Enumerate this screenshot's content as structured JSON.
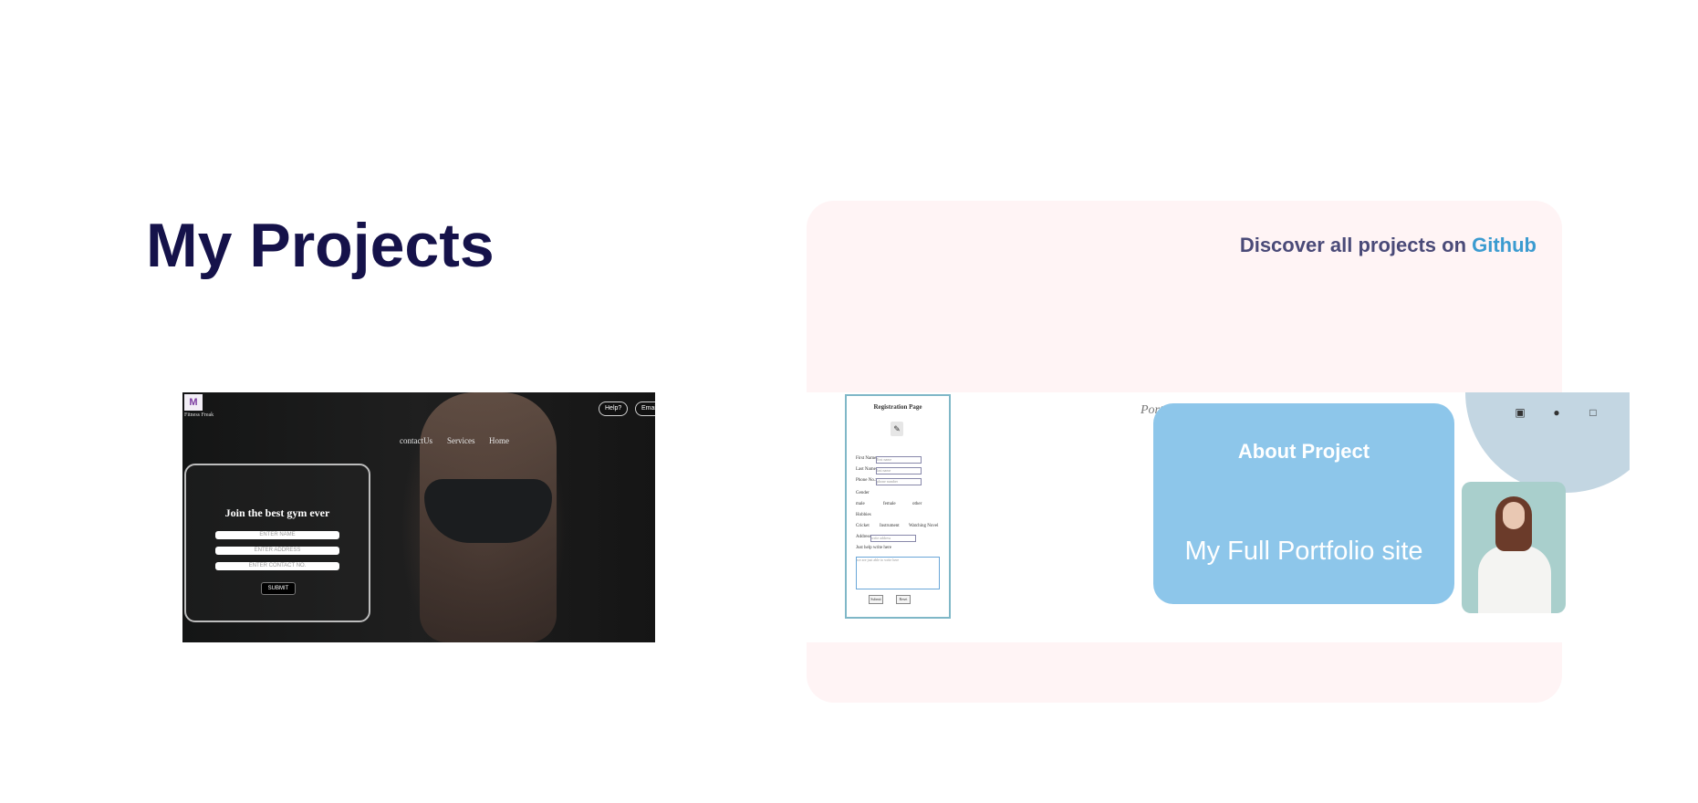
{
  "page": {
    "title": "My Projects"
  },
  "discover": {
    "text": "Discover all projects on ",
    "link": "Github"
  },
  "gym_preview": {
    "logo": "M",
    "logo_caption": "Fitness Freak",
    "top_buttons": [
      "Help?",
      "Email"
    ],
    "nav": [
      "contactUs",
      "Services",
      "Home"
    ],
    "form_title": "Join the best gym ever",
    "placeholders": [
      "ENTER NAME",
      "ENTER ADDRESS",
      "ENTER CONTACT NO."
    ],
    "submit": "SUBMIT"
  },
  "registration_preview": {
    "title": "Registration Page",
    "labels": [
      "First Name:",
      "Last Name:",
      "Phone No.:",
      "Gender",
      "Hobbies",
      "Address",
      "Just help write here"
    ],
    "placeholders": [
      "first name",
      "last name",
      "phone number",
      "write address",
      "we are just able to write here"
    ],
    "genders": [
      "male",
      "female",
      "other"
    ],
    "hobbies": [
      "Cricket",
      "Instrument",
      "Watching Novel"
    ],
    "buttons": [
      "Submit",
      "Reset"
    ]
  },
  "portfolio_preview": {
    "brand": "Port",
    "social_icons": [
      "instagram-icon",
      "github-icon",
      "linkedin-icon"
    ]
  },
  "about_card": {
    "title": "About Project",
    "subtitle": "My Full Portfolio site"
  }
}
